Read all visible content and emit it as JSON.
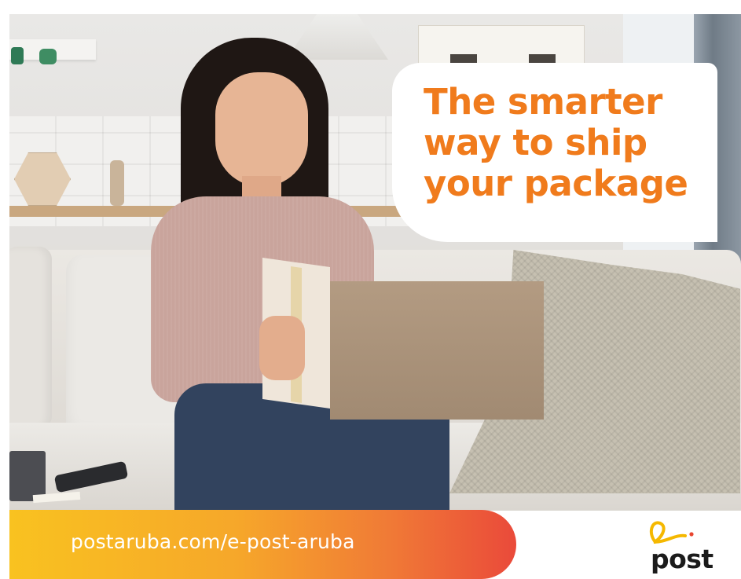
{
  "headline": {
    "line1": "The smarter",
    "line2": "way to ship",
    "line3": "your package"
  },
  "footer": {
    "url": "postaruba.com/e-post-aruba",
    "logo_text": "post"
  },
  "colors": {
    "headline": "#f07b1c",
    "bar_start": "#f9c220",
    "bar_end": "#ea4a3a",
    "logo_swirl": "#f5b800",
    "logo_dot": "#e8452f"
  },
  "image": {
    "icon": "woman-opening-package-photo"
  }
}
